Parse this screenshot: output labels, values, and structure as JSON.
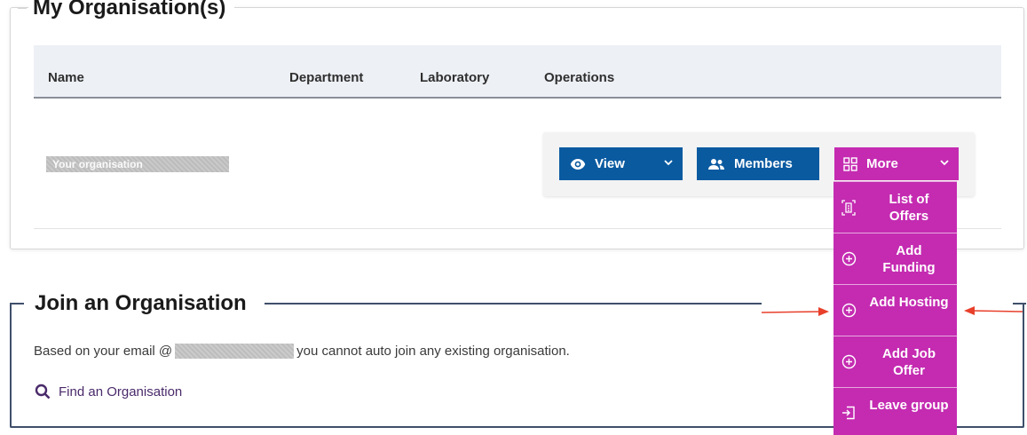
{
  "my_orgs": {
    "title": "My Organisation(s)",
    "columns": [
      "Name",
      "Department",
      "Laboratory",
      "Operations"
    ],
    "rows": [
      {
        "name": "Your organisation"
      }
    ],
    "operations": {
      "view_label": "View",
      "members_label": "Members",
      "more_label": "More"
    }
  },
  "more_menu": {
    "items": [
      {
        "label": "List of Offers",
        "icon": "list-document-icon"
      },
      {
        "label": "Add Funding",
        "icon": "plus-circle-icon"
      },
      {
        "label": "Add Hosting",
        "icon": "plus-circle-icon"
      },
      {
        "label": "Add Job Offer",
        "icon": "plus-circle-icon"
      },
      {
        "label": "Leave group",
        "icon": "exit-icon"
      }
    ]
  },
  "join": {
    "title": "Join an Organisation",
    "text_before": "Based on your email @",
    "text_after": "you cannot auto join any existing organisation.",
    "find_link": "Find an Organisation"
  },
  "colors": {
    "primary_button": "#0a5aa0",
    "more_menu": "#c42bb1",
    "annotation_arrow": "#e8402b"
  }
}
